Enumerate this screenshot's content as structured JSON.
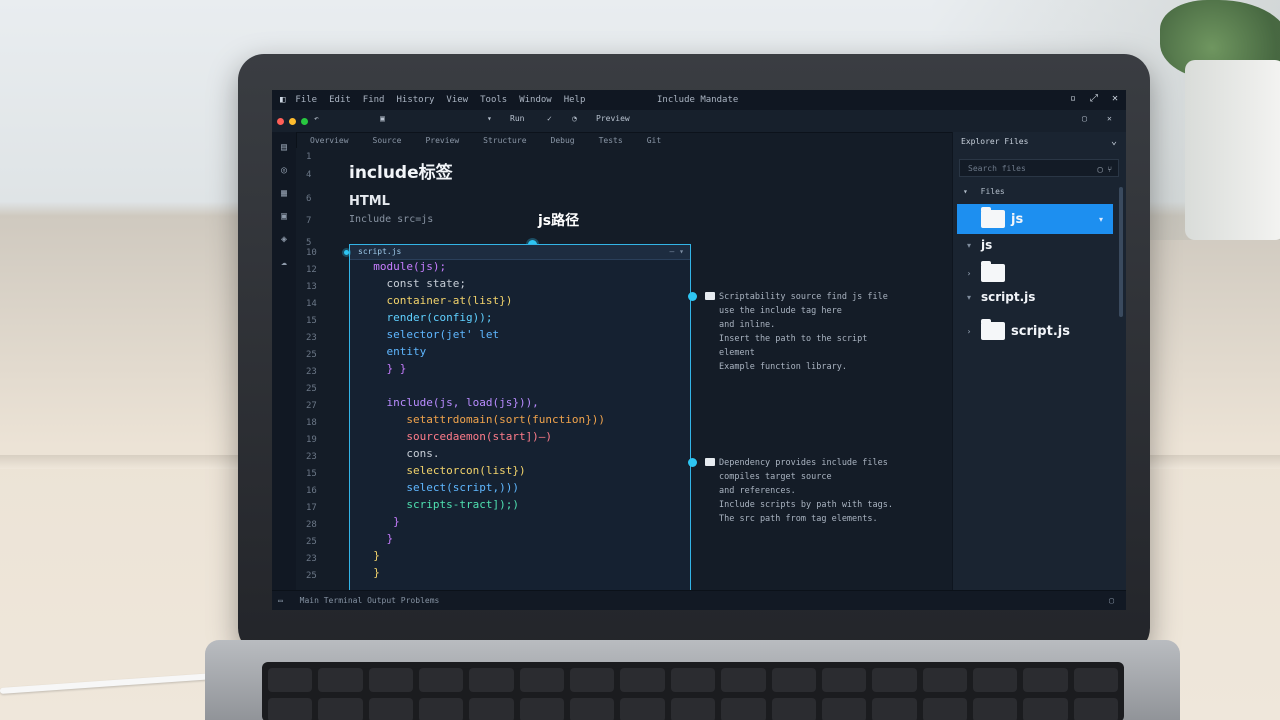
{
  "window": {
    "title": "Include Mandate",
    "menu": [
      "File",
      "Edit",
      "Find",
      "History",
      "View",
      "Tools",
      "Window",
      "Help"
    ]
  },
  "toolbar": {
    "run_label": "Run",
    "preview_label": "Preview",
    "dots": [
      "#ff5f57",
      "#febc2e",
      "#28c840"
    ]
  },
  "tabs": [
    "Overview",
    "Source",
    "Preview",
    "Structure",
    "Debug",
    "Tests",
    "Git"
  ],
  "document": {
    "heading": "include标签",
    "subheading": "HTML",
    "subline": "Include src=js"
  },
  "annotation": {
    "label": "js路径"
  },
  "code_panel": {
    "title": "script.js",
    "lines": [
      {
        "n": "10",
        "text": "",
        "color": "#d2d8e0"
      },
      {
        "n": "12",
        "text": "  module(js);",
        "color": "#c77dff"
      },
      {
        "n": "13",
        "text": "    const state;",
        "color": "#c6cdd6"
      },
      {
        "n": "14",
        "text": "    container-at(list})",
        "color": "#f2d36b"
      },
      {
        "n": "15",
        "text": "    render(config));",
        "color": "#5fd0ff"
      },
      {
        "n": "23",
        "text": "    selector(jet' let",
        "color": "#5fb7ff"
      },
      {
        "n": "25",
        "text": "    entity",
        "color": "#5fb7ff"
      },
      {
        "n": "23",
        "text": "    } }",
        "color": "#c77dff"
      },
      {
        "n": "25",
        "text": "",
        "color": "#d2d8e0"
      },
      {
        "n": "27",
        "text": "    include(js, load(js})),",
        "color": "#b98cff"
      },
      {
        "n": "18",
        "text": "       setattrdomain(sort(function}))",
        "color": "#f0a34c"
      },
      {
        "n": "19",
        "text": "       sourcedaemon(start])—)",
        "color": "#ff7c8a"
      },
      {
        "n": "23",
        "text": "       cons.",
        "color": "#c6cdd6"
      },
      {
        "n": "15",
        "text": "       selectorcon(list})",
        "color": "#f2d36b"
      },
      {
        "n": "16",
        "text": "       select(script,)))",
        "color": "#5fb7ff"
      },
      {
        "n": "17",
        "text": "       scripts-tract]);)",
        "color": "#4fe0b0"
      },
      {
        "n": "28",
        "text": "     }",
        "color": "#c77dff"
      },
      {
        "n": "25",
        "text": "    }",
        "color": "#c77dff"
      },
      {
        "n": "23",
        "text": "  }",
        "color": "#f2d36b"
      },
      {
        "n": "25",
        "text": "  }",
        "color": "#f2d36b"
      }
    ]
  },
  "gutter_top": [
    "1",
    "4",
    "6",
    "7",
    "5"
  ],
  "notes": [
    {
      "lines": [
        "Scriptability source find js file ",
        "use the include tag here",
        "and inline.",
        "Insert the path to the script element",
        "Example function library."
      ]
    },
    {
      "lines": [
        "Dependency provides include files",
        "compiles target source",
        "and references.",
        "Include scripts by path with tags.",
        "The src path from tag elements."
      ]
    }
  ],
  "explorer": {
    "title": "Explorer  Files",
    "search_placeholder": "Search files",
    "root_label": "Files",
    "items": [
      {
        "label": "js",
        "selected": true,
        "folder": true
      },
      {
        "label": "js",
        "selected": false,
        "folder": false
      },
      {
        "label": "",
        "selected": false,
        "folder": true
      },
      {
        "label": "script.js",
        "selected": false,
        "folder": false
      },
      {
        "label": "script.js",
        "selected": false,
        "folder": true
      }
    ]
  },
  "statusbar": {
    "text": "Main  Terminal  Output  Problems"
  }
}
